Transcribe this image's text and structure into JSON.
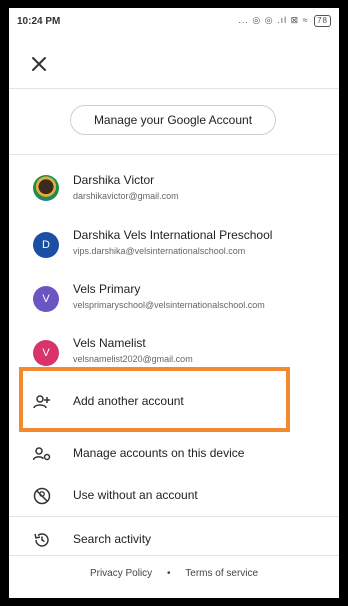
{
  "status_bar": {
    "time": "10:24 PM",
    "icons": "... ◎ ◎ .ıl ⊠ ≈",
    "battery": "78"
  },
  "header": {
    "close_icon": "close-icon"
  },
  "manage_account": {
    "label": "Manage your Google Account"
  },
  "accounts": [
    {
      "name": "Darshika Victor",
      "email": "darshikavictor@gmail.com",
      "avatar_letter": "",
      "avatar_color": "#8a5a2b"
    },
    {
      "name": "Darshika Vels International Preschool",
      "email": "vips.darshika@velsinternationalschool.com",
      "avatar_letter": "D",
      "avatar_color": "#1a4fa3"
    },
    {
      "name": "Vels Primary",
      "email": "velsprimaryschool@velsinternationalschool.com",
      "avatar_letter": "V",
      "avatar_color": "#6a55c2"
    },
    {
      "name": "Vels Namelist",
      "email": "velsnamelist2020@gmail.com",
      "avatar_letter": "V",
      "avatar_color": "#d8336a"
    }
  ],
  "menu": {
    "add_account": "Add another account",
    "manage_accounts": "Manage accounts on this device",
    "use_without": "Use without an account",
    "search_activity": "Search activity"
  },
  "footer": {
    "privacy": "Privacy Policy",
    "separator": "•",
    "terms": "Terms of service"
  },
  "colors": {
    "highlight": "#f28a30"
  }
}
